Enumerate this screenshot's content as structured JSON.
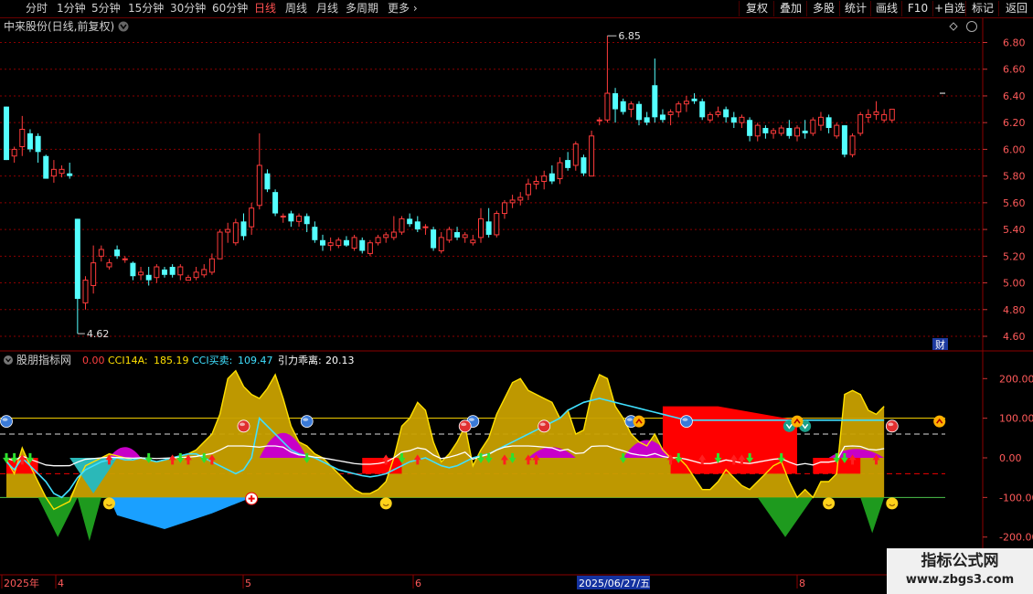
{
  "toolbar": {
    "periods": [
      "分时",
      "1分钟",
      "5分钟",
      "15分钟",
      "30分钟",
      "60分钟",
      "日线",
      "周线",
      "月线",
      "多周期",
      "更多"
    ],
    "active_period": "日线",
    "right_buttons": [
      "复权",
      "叠加",
      "多股",
      "统计",
      "画线",
      "F10",
      "+自选",
      "标记",
      "返回"
    ]
  },
  "main_panel": {
    "title": "中来股份(日线,前复权)",
    "high_label": "6.85",
    "low_label": "4.62",
    "finance_badge": "财",
    "price_ticks": [
      "6.80",
      "6.60",
      "6.40",
      "6.20",
      "6.00",
      "5.80",
      "5.60",
      "5.40",
      "5.20",
      "5.00",
      "4.80",
      "4.60"
    ]
  },
  "indicator_panel": {
    "name": "股朋指标网",
    "value0": "0.00",
    "cci14a_label": "CCI14A:",
    "cci14a_value": "185.19",
    "cci_trade_label": "CCI买卖:",
    "cci_trade_value": "109.47",
    "gravity_label": "引力乖离:",
    "gravity_value": "20.13",
    "ticks": [
      "200.00",
      "100.00",
      "0.00",
      "-100.00",
      "-200.00"
    ]
  },
  "date_axis": {
    "labels": [
      "2025年",
      "4",
      "5",
      "6",
      "8"
    ],
    "cursor_date": "2025/06/27/五"
  },
  "watermark": {
    "title": "指标公式网",
    "url": "www.zbgs3.com"
  },
  "colors": {
    "up": "#ff3b3b",
    "down": "#54ffff",
    "gold": "#c8a000",
    "magenta": "#c800c8",
    "grid": "#8b0000"
  },
  "chart_data": {
    "type": "candlestick",
    "price_range": [
      4.55,
      6.88
    ],
    "candles_ohlc": [
      [
        6.32,
        6.32,
        5.92,
        5.92
      ],
      [
        5.95,
        6.02,
        5.9,
        6.0
      ],
      [
        6.02,
        6.25,
        5.95,
        6.15
      ],
      [
        6.12,
        6.15,
        5.98,
        6.0
      ],
      [
        6.1,
        6.12,
        5.9,
        5.98
      ],
      [
        5.95,
        5.96,
        5.78,
        5.78
      ],
      [
        5.8,
        5.92,
        5.75,
        5.85
      ],
      [
        5.82,
        5.88,
        5.79,
        5.85
      ],
      [
        5.82,
        5.9,
        5.78,
        5.8
      ],
      [
        5.48,
        5.48,
        4.62,
        4.88
      ],
      [
        4.85,
        5.05,
        4.8,
        5.02
      ],
      [
        4.98,
        5.28,
        4.92,
        5.15
      ],
      [
        5.2,
        5.28,
        5.16,
        5.25
      ],
      [
        5.12,
        5.18,
        5.1,
        5.15
      ],
      [
        5.25,
        5.28,
        5.18,
        5.2
      ],
      [
        5.18,
        5.2,
        5.15,
        5.18
      ],
      [
        5.15,
        5.16,
        5.02,
        5.05
      ],
      [
        5.06,
        5.12,
        5.02,
        5.08
      ],
      [
        5.06,
        5.12,
        4.98,
        5.02
      ],
      [
        5.04,
        5.14,
        5.0,
        5.12
      ],
      [
        5.1,
        5.12,
        5.04,
        5.06
      ],
      [
        5.12,
        5.14,
        5.04,
        5.06
      ],
      [
        5.06,
        5.14,
        5.02,
        5.12
      ],
      [
        5.02,
        5.06,
        5.02,
        5.04
      ],
      [
        5.04,
        5.12,
        5.02,
        5.08
      ],
      [
        5.06,
        5.14,
        5.04,
        5.1
      ],
      [
        5.08,
        5.22,
        5.06,
        5.18
      ],
      [
        5.18,
        5.4,
        5.18,
        5.38
      ],
      [
        5.38,
        5.45,
        5.3,
        5.4
      ],
      [
        5.3,
        5.48,
        5.28,
        5.45
      ],
      [
        5.46,
        5.52,
        5.32,
        5.35
      ],
      [
        5.42,
        5.6,
        5.36,
        5.56
      ],
      [
        5.58,
        6.12,
        5.55,
        5.88
      ],
      [
        5.82,
        5.85,
        5.68,
        5.7
      ],
      [
        5.68,
        5.7,
        5.5,
        5.52
      ],
      [
        5.5,
        5.52,
        5.45,
        5.5
      ],
      [
        5.52,
        5.54,
        5.42,
        5.46
      ],
      [
        5.46,
        5.52,
        5.42,
        5.5
      ],
      [
        5.5,
        5.52,
        5.38,
        5.44
      ],
      [
        5.42,
        5.46,
        5.3,
        5.32
      ],
      [
        5.32,
        5.36,
        5.24,
        5.28
      ],
      [
        5.28,
        5.34,
        5.24,
        5.3
      ],
      [
        5.28,
        5.34,
        5.26,
        5.32
      ],
      [
        5.32,
        5.35,
        5.27,
        5.28
      ],
      [
        5.26,
        5.36,
        5.24,
        5.34
      ],
      [
        5.32,
        5.34,
        5.22,
        5.24
      ],
      [
        5.22,
        5.32,
        5.2,
        5.3
      ],
      [
        5.3,
        5.36,
        5.28,
        5.34
      ],
      [
        5.34,
        5.38,
        5.3,
        5.36
      ],
      [
        5.34,
        5.5,
        5.32,
        5.38
      ],
      [
        5.38,
        5.5,
        5.36,
        5.48
      ],
      [
        5.48,
        5.52,
        5.42,
        5.44
      ],
      [
        5.46,
        5.5,
        5.38,
        5.4
      ],
      [
        5.42,
        5.44,
        5.36,
        5.42
      ],
      [
        5.4,
        5.42,
        5.24,
        5.26
      ],
      [
        5.24,
        5.38,
        5.22,
        5.34
      ],
      [
        5.32,
        5.42,
        5.3,
        5.4
      ],
      [
        5.38,
        5.42,
        5.32,
        5.34
      ],
      [
        5.34,
        5.38,
        5.3,
        5.36
      ],
      [
        5.3,
        5.36,
        5.28,
        5.32
      ],
      [
        5.34,
        5.56,
        5.3,
        5.48
      ],
      [
        5.46,
        5.56,
        5.34,
        5.36
      ],
      [
        5.36,
        5.54,
        5.34,
        5.52
      ],
      [
        5.52,
        5.62,
        5.48,
        5.6
      ],
      [
        5.6,
        5.66,
        5.56,
        5.62
      ],
      [
        5.62,
        5.68,
        5.58,
        5.64
      ],
      [
        5.66,
        5.78,
        5.62,
        5.74
      ],
      [
        5.74,
        5.8,
        5.7,
        5.76
      ],
      [
        5.76,
        5.84,
        5.7,
        5.8
      ],
      [
        5.82,
        5.88,
        5.74,
        5.76
      ],
      [
        5.78,
        5.94,
        5.74,
        5.9
      ],
      [
        5.92,
        5.98,
        5.84,
        5.86
      ],
      [
        5.88,
        6.06,
        5.84,
        6.04
      ],
      [
        5.94,
        5.96,
        5.8,
        5.82
      ],
      [
        5.8,
        6.14,
        5.8,
        6.1
      ],
      [
        6.22,
        6.24,
        6.18,
        6.22
      ],
      [
        6.22,
        6.85,
        6.2,
        6.42
      ],
      [
        6.42,
        6.46,
        6.2,
        6.3
      ],
      [
        6.36,
        6.38,
        6.26,
        6.28
      ],
      [
        6.3,
        6.36,
        6.24,
        6.34
      ],
      [
        6.34,
        6.36,
        6.18,
        6.22
      ],
      [
        6.24,
        6.28,
        6.18,
        6.2
      ],
      [
        6.48,
        6.68,
        6.2,
        6.24
      ],
      [
        6.26,
        6.3,
        6.2,
        6.22
      ],
      [
        6.26,
        6.3,
        6.18,
        6.28
      ],
      [
        6.28,
        6.36,
        6.24,
        6.34
      ],
      [
        6.34,
        6.4,
        6.28,
        6.36
      ],
      [
        6.38,
        6.42,
        6.34,
        6.36
      ],
      [
        6.36,
        6.38,
        6.22,
        6.24
      ],
      [
        6.22,
        6.28,
        6.2,
        6.26
      ],
      [
        6.26,
        6.32,
        6.24,
        6.28
      ],
      [
        6.3,
        6.32,
        6.2,
        6.24
      ],
      [
        6.24,
        6.28,
        6.16,
        6.2
      ],
      [
        6.2,
        6.26,
        6.16,
        6.24
      ],
      [
        6.22,
        6.24,
        6.06,
        6.1
      ],
      [
        6.1,
        6.2,
        6.06,
        6.18
      ],
      [
        6.16,
        6.18,
        6.08,
        6.12
      ],
      [
        6.12,
        6.16,
        6.08,
        6.14
      ],
      [
        6.12,
        6.18,
        6.1,
        6.16
      ],
      [
        6.16,
        6.22,
        6.08,
        6.1
      ],
      [
        6.1,
        6.18,
        6.06,
        6.16
      ],
      [
        6.14,
        6.22,
        6.08,
        6.12
      ],
      [
        6.12,
        6.24,
        6.1,
        6.22
      ],
      [
        6.18,
        6.28,
        6.14,
        6.24
      ],
      [
        6.24,
        6.26,
        6.12,
        6.16
      ],
      [
        6.1,
        6.2,
        6.08,
        6.18
      ],
      [
        6.18,
        6.18,
        5.94,
        5.96
      ],
      [
        5.96,
        6.12,
        5.94,
        6.1
      ],
      [
        6.12,
        6.28,
        6.1,
        6.26
      ],
      [
        6.24,
        6.3,
        6.2,
        6.26
      ],
      [
        6.26,
        6.36,
        6.22,
        6.28
      ],
      [
        6.22,
        6.3,
        6.2,
        6.26
      ],
      [
        6.22,
        6.3,
        6.2,
        6.3
      ]
    ],
    "indicator": {
      "range": [
        -230,
        240
      ],
      "gold_upper": [
        -5,
        -40,
        25,
        -20,
        -60,
        -100,
        -130,
        -120,
        -110,
        -60,
        -20,
        -10,
        0,
        10,
        5,
        0,
        -5,
        0,
        -5,
        -10,
        -5,
        0,
        5,
        10,
        20,
        40,
        60,
        110,
        200,
        220,
        180,
        160,
        150,
        175,
        210,
        150,
        80,
        40,
        30,
        10,
        0,
        -20,
        -40,
        -60,
        -80,
        -90,
        -90,
        -80,
        -60,
        0,
        80,
        100,
        140,
        120,
        40,
        -10,
        10,
        40,
        80,
        -20,
        20,
        50,
        110,
        150,
        190,
        200,
        170,
        160,
        150,
        140,
        100,
        120,
        60,
        70,
        160,
        210,
        200,
        130,
        100,
        60,
        40,
        30,
        60,
        20,
        0,
        0,
        -20,
        -50,
        -80,
        -80,
        -60,
        -30,
        -50,
        -70,
        -80,
        -60,
        -40,
        -20,
        -10,
        -60,
        -100,
        -80,
        -100,
        -60,
        -60,
        -40,
        160,
        170,
        160,
        120,
        110,
        130
      ],
      "cyan_line": [
        -10,
        -30,
        0,
        -20,
        -40,
        -60,
        -90,
        -100,
        -80,
        -50,
        -30,
        -20,
        -10,
        -5,
        0,
        -5,
        -5,
        0,
        -5,
        -10,
        -5,
        0,
        5,
        10,
        10,
        0,
        -10,
        -20,
        -30,
        -40,
        -30,
        0,
        100,
        80,
        60,
        40,
        20,
        10,
        5,
        0,
        -10,
        -20,
        -30,
        -35,
        -40,
        -45,
        -48,
        -45,
        -40,
        -30,
        -20,
        -10,
        -5,
        0,
        -10,
        -20,
        -25,
        -20,
        -10,
        0,
        5,
        10,
        20,
        30,
        40,
        50,
        60,
        70,
        80,
        90,
        100,
        120,
        130,
        140,
        145,
        150,
        145,
        140,
        135,
        130,
        125,
        120,
        115,
        110,
        105,
        100,
        95,
        95,
        95,
        95,
        95,
        95,
        95,
        95,
        95,
        95,
        95,
        95,
        95,
        95,
        95,
        95,
        95,
        95,
        95,
        95,
        95,
        95,
        95,
        95,
        95,
        95,
        95,
        95,
        95,
        95,
        95,
        95,
        95
      ]
    }
  }
}
